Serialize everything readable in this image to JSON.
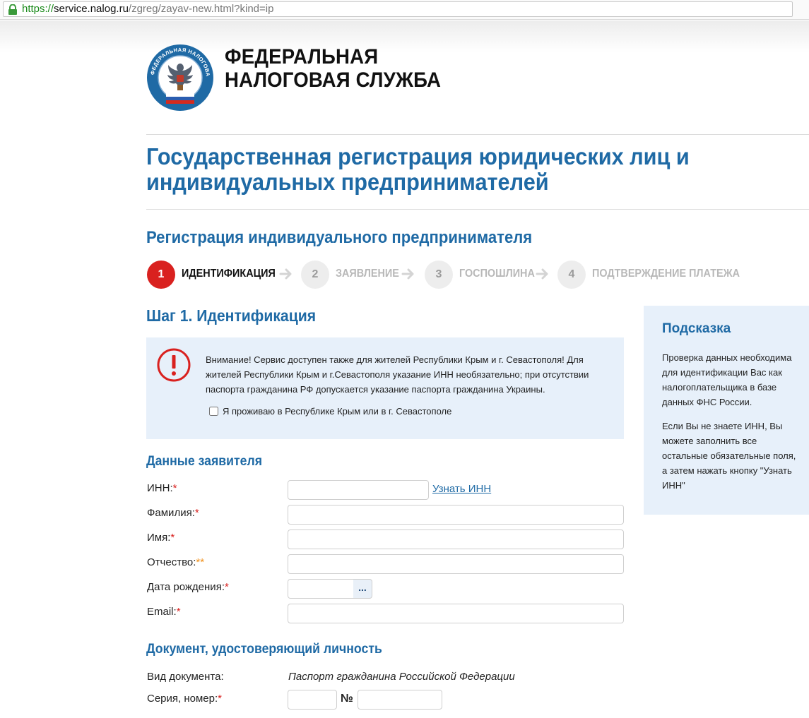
{
  "browser": {
    "url_scheme": "https://",
    "url_host": "service.nalog.ru",
    "url_path": "/zgreg/zayav-new.html?kind=ip"
  },
  "header": {
    "org_line1": "ФЕДЕРАЛЬНАЯ",
    "org_line2": "НАЛОГОВАЯ СЛУЖБА",
    "logo_text": "ФЕДЕРАЛЬНАЯ НАЛОГОВАЯ СЛУЖБА"
  },
  "page": {
    "title_line1": "Государственная регистрация юридических лиц и",
    "title_line2": "индивидуальных предпринимателей",
    "subtitle": "Регистрация индивидуального предпринимателя"
  },
  "steps": [
    {
      "number": "1",
      "label": "ИДЕНТИФИКАЦИЯ",
      "active": true
    },
    {
      "number": "2",
      "label": "ЗАЯВЛЕНИЕ",
      "active": false
    },
    {
      "number": "3",
      "label": "ГОСПОШЛИНА",
      "active": false
    },
    {
      "number": "4",
      "label": "ПОДТВЕРЖДЕНИЕ ПЛАТЕЖА",
      "active": false
    }
  ],
  "step_heading": "Шаг 1. Идентификация",
  "notice": {
    "line1": "Внимание! Сервис доступен также для жителей Республики Крым и г. Севастополя! Для",
    "line2": "жителей Республики Крым и г.Севастополя указание ИНН необязательно; при отсутствии",
    "line3": "паспорта гражданина РФ допускается указание паспорта гражданина Украины.",
    "checkbox_label": "Я проживаю в Республике Крым или в г. Севастополе"
  },
  "hint": {
    "title": "Подсказка",
    "p1_l1": "Проверка данных необходима",
    "p1_l2": "для идентификации Вас как",
    "p1_l3": "налогоплательщика в базе",
    "p1_l4": "данных ФНС России.",
    "p2_l1": "Если Вы не знаете ИНН, Вы",
    "p2_l2": "можете заполнить все",
    "p2_l3": "остальные обязательные поля,",
    "p2_l4": "а затем нажать кнопку \"Узнать",
    "p2_l5": "ИНН\""
  },
  "applicant": {
    "title": "Данные заявителя",
    "inn_label": "ИНН:",
    "inn_link": "Узнать ИНН",
    "surname_label": "Фамилия:",
    "name_label": "Имя:",
    "patronymic_label": "Отчество:",
    "birthdate_label": "Дата рождения:",
    "date_button": "...",
    "email_label": "Email:",
    "req_mark": "*",
    "req_mark2": "**"
  },
  "document": {
    "title": "Документ, удостоверяющий личность",
    "type_label": "Вид документа:",
    "type_value": "Паспорт гражданина Российской Федерации",
    "series_label": "Серия, номер:",
    "number_sign": "№"
  },
  "colors": {
    "accent_blue": "#1f6aa5",
    "active_red": "#d9211f",
    "panel_bg": "#e7f0fa"
  }
}
